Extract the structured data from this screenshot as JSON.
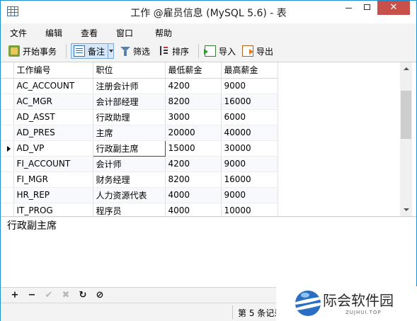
{
  "window": {
    "title": "工作 @雇员信息 (MySQL 5.6) - 表",
    "close_glyph": "✕"
  },
  "menu": [
    "文件",
    "编辑",
    "查看",
    "窗口",
    "帮助"
  ],
  "toolbar": {
    "begin_transaction": "开始事务",
    "memo": "备注",
    "filter": "筛选",
    "sort": "排序",
    "import": "导入",
    "export": "导出"
  },
  "table": {
    "columns": [
      "工作编号",
      "职位",
      "最低薪金",
      "最高薪金"
    ],
    "rows": [
      [
        "AC_ACCOUNT",
        "注册会计师",
        "4200",
        "9000"
      ],
      [
        "AC_MGR",
        "会计部经理",
        "8200",
        "16000"
      ],
      [
        "AD_ASST",
        "行政助理",
        "3000",
        "6000"
      ],
      [
        "AD_PRES",
        "主席",
        "20000",
        "40000"
      ],
      [
        "AD_VP",
        "行政副主席",
        "15000",
        "30000"
      ],
      [
        "FI_ACCOUNT",
        "会计师",
        "4200",
        "9000"
      ],
      [
        "FI_MGR",
        "财务经理",
        "8200",
        "16000"
      ],
      [
        "HR_REP",
        "人力资源代表",
        "4000",
        "9000"
      ],
      [
        "IT_PROG",
        "程序员",
        "4000",
        "10000"
      ]
    ],
    "current_row": 4
  },
  "memo_text": "行政副主席",
  "navbar": {
    "add": "+",
    "delete": "−",
    "apply": "✔",
    "discard": "✖",
    "refresh": "↻",
    "stop": "⊘"
  },
  "status": "第 5 条记录",
  "watermark": {
    "name": "际会软件园",
    "sub": "ZUJHUI.TOP"
  }
}
